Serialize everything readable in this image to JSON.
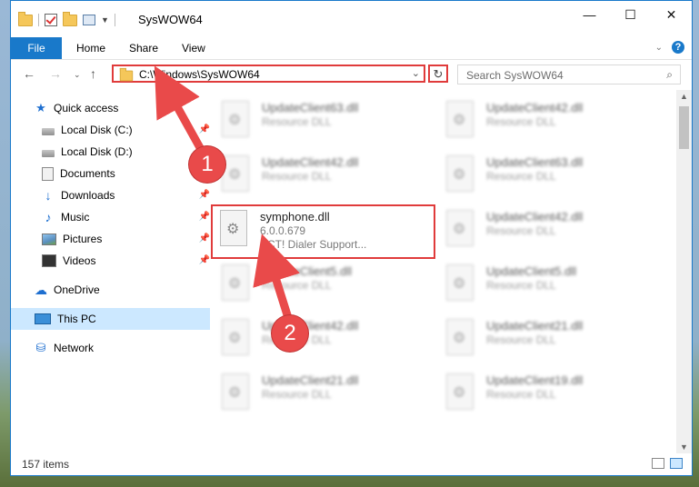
{
  "window": {
    "title": "SysWOW64",
    "controls": {
      "minimize": "—",
      "maximize": "☐",
      "close": "✕"
    }
  },
  "ribbon": {
    "tabs": [
      "File",
      "Home",
      "Share",
      "View"
    ],
    "expand_icon": "chevron-down-icon",
    "help_label": "?"
  },
  "address": {
    "path": "C:\\Windows\\SysWOW64",
    "search_placeholder": "Search SysWOW64"
  },
  "sidebar": {
    "items": [
      {
        "label": "Quick access",
        "icon": "quick-access-star-icon",
        "pinned": false
      },
      {
        "label": "Local Disk (C:)",
        "icon": "drive-icon",
        "pinned": true
      },
      {
        "label": "Local Disk (D:)",
        "icon": "drive-icon",
        "pinned": true
      },
      {
        "label": "Documents",
        "icon": "documents-icon",
        "pinned": true
      },
      {
        "label": "Downloads",
        "icon": "download-icon",
        "pinned": true
      },
      {
        "label": "Music",
        "icon": "music-icon",
        "pinned": true
      },
      {
        "label": "Pictures",
        "icon": "pictures-icon",
        "pinned": true
      },
      {
        "label": "Videos",
        "icon": "videos-icon",
        "pinned": true
      },
      {
        "label": "OneDrive",
        "icon": "onedrive-cloud-icon",
        "pinned": false
      },
      {
        "label": "This PC",
        "icon": "computer-icon",
        "pinned": false,
        "selected": true
      },
      {
        "label": "Network",
        "icon": "network-icon",
        "pinned": false
      }
    ]
  },
  "files": [
    {
      "name": "UpdateClient63.dll",
      "desc": "Resource DLL",
      "blurred": true
    },
    {
      "name": "UpdateClient42.dll",
      "desc": "Resource DLL",
      "blurred": true
    },
    {
      "name": "UpdateClient42.dll",
      "desc": "Resource DLL",
      "blurred": true
    },
    {
      "name": "UpdateClient63.dll",
      "desc": "Resource DLL",
      "blurred": true
    },
    {
      "name": "symphone.dll",
      "desc": "6.0.0.679",
      "desc2": "ACT! Dialer Support...",
      "blurred": false
    },
    {
      "name": "UpdateClient42.dll",
      "desc": "Resource DLL",
      "blurred": true
    },
    {
      "name": "UpdateClient5.dll",
      "desc": "Resource DLL",
      "blurred": true
    },
    {
      "name": "UpdateClient5.dll",
      "desc": "Resource DLL",
      "blurred": true
    },
    {
      "name": "UpdateClient42.dll",
      "desc": "Resource DLL",
      "blurred": true
    },
    {
      "name": "UpdateClient21.dll",
      "desc": "Resource DLL",
      "blurred": true
    },
    {
      "name": "UpdateClient21.dll",
      "desc": "Resource DLL",
      "blurred": true
    },
    {
      "name": "UpdateClient19.dll",
      "desc": "Resource DLL",
      "blurred": true
    }
  ],
  "status": {
    "item_count": "157 items"
  },
  "annotations": {
    "step1": "1",
    "step2": "2"
  },
  "colors": {
    "accent": "#1979ca",
    "highlight": "#e03b3b",
    "selected": "#cce8ff"
  }
}
